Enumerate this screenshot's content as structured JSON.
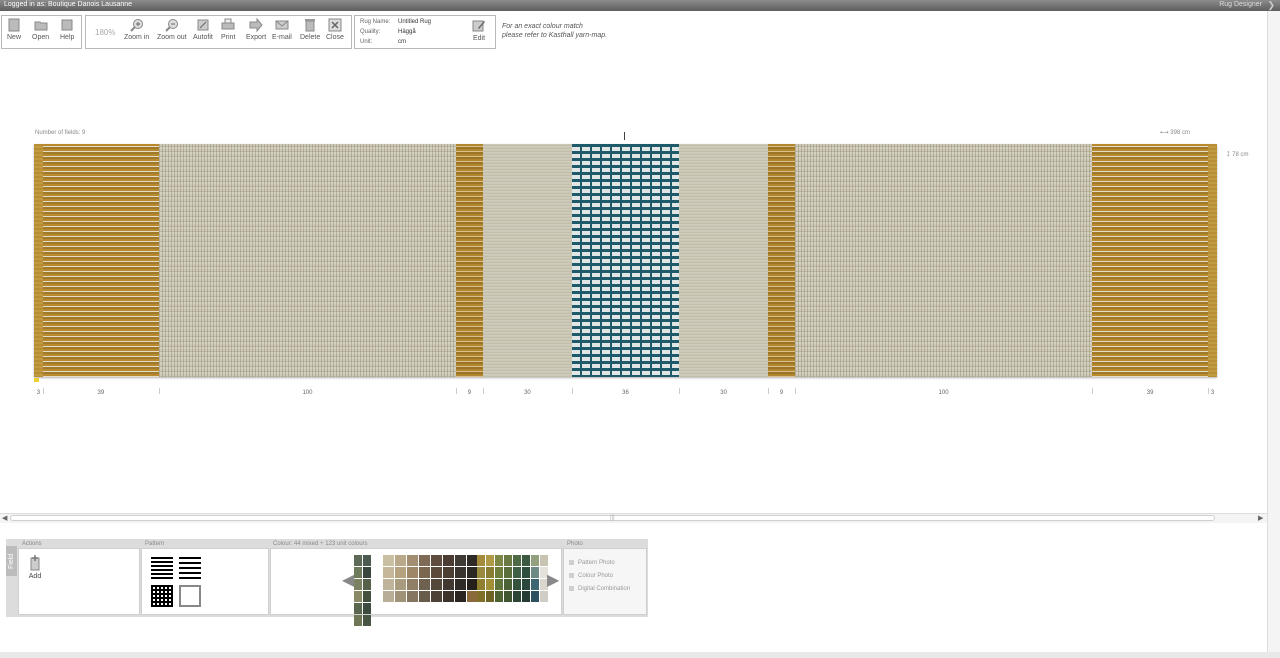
{
  "header": {
    "login_text": "Logged in as: Boutique Danois Lausanne",
    "app_name": "Rug Designer",
    "collapse_icon": "chevron-right-icon"
  },
  "toolbar": {
    "new": "New",
    "open": "Open",
    "help": "Help",
    "zoom_level": "180%",
    "zoom_in": "Zoom in",
    "zoom_out": "Zoom out",
    "autofit": "Autofit",
    "print": "Print",
    "export": "Export",
    "email": "E-mail",
    "delete": "Delete",
    "close": "Close"
  },
  "rug_info": {
    "name_label": "Rug Name:",
    "name_value": "Untitled Rug",
    "quality_label": "Quality:",
    "quality_value": "Häggå",
    "unit_label": "Unit:",
    "unit_value": "cm",
    "edit_label": "Edit"
  },
  "colour_note_line1": "For an exact colour match",
  "colour_note_line2": "please refer to Kasthall yarn-map.",
  "canvas": {
    "fields_count": "Number of fields: 9",
    "width_text": "398 cm",
    "height_text": "78 cm",
    "fields": [
      {
        "width_cm": "3",
        "style": "ochre-edge"
      },
      {
        "width_cm": "39",
        "style": "ochre-mix"
      },
      {
        "width_cm": "100",
        "style": "beige-wave"
      },
      {
        "width_cm": "9",
        "style": "ochre-narrow"
      },
      {
        "width_cm": "30",
        "style": "beige-plain"
      },
      {
        "width_cm": "36",
        "style": "teal-dash"
      },
      {
        "width_cm": "30",
        "style": "beige-plain"
      },
      {
        "width_cm": "9",
        "style": "ochre-narrow"
      },
      {
        "width_cm": "100",
        "style": "beige-wave"
      },
      {
        "width_cm": "39",
        "style": "ochre-mix"
      },
      {
        "width_cm": "3",
        "style": "ochre-edge"
      }
    ]
  },
  "panel": {
    "side_tab": "Field",
    "actions_title": "Actions",
    "add_label": "Add",
    "pattern_title": "Pattern",
    "colour_title": "Colour: 44 mixed + 123 unit colours",
    "photo_title": "Photo",
    "photo_items": [
      "Pattern Photo",
      "Colour Photo",
      "Digital Combination"
    ],
    "swatches_a": [
      "#5d6a55",
      "#4c5a4f",
      "#6e7b5b",
      "#3b463f",
      "#7a8262",
      "#56604a",
      "#8b8a66",
      "#45503f",
      "#5a6650",
      "#3d4a40",
      "#6f7757",
      "#485444"
    ],
    "swatches_b": [
      "#cbbfa2",
      "#b9a98a",
      "#a38e72",
      "#7e6a55",
      "#5f4c3e",
      "#4a3c32",
      "#3f3a34",
      "#2f2a26",
      "#c7b79a",
      "#b5a27f",
      "#9e8767",
      "#7b6650",
      "#5b4a3b",
      "#4b3f33",
      "#3a342f",
      "#2b2723",
      "#bfb39b",
      "#a99b7d",
      "#8f7f65",
      "#6f614f",
      "#54483b",
      "#403831",
      "#2f2a25",
      "#241f1b",
      "#b8ad95",
      "#a09278",
      "#85775f",
      "#695b49",
      "#4d4236",
      "#3a322b",
      "#2a2520",
      "#8a6a3a"
    ],
    "swatches_c": [
      "#a48b3c",
      "#b09a48",
      "#7d8846",
      "#6b7a43",
      "#4e6a45",
      "#3c5a42",
      "#93a07e",
      "#c9c4b1",
      "#9a8a3e",
      "#8b7c34",
      "#6d7d3e",
      "#5a6e3c",
      "#3f5f44",
      "#2f4d3d",
      "#6d8a84",
      "#e3e1da",
      "#8f7f2e",
      "#a08f36",
      "#5f743a",
      "#4b6336",
      "#35523c",
      "#2b463a",
      "#3b6672",
      "#d9d6cd",
      "#7f6f28",
      "#6e6226",
      "#4e6232",
      "#3f5530",
      "#2d4534",
      "#243c33",
      "#2a5060",
      "#cfcdc5"
    ]
  }
}
